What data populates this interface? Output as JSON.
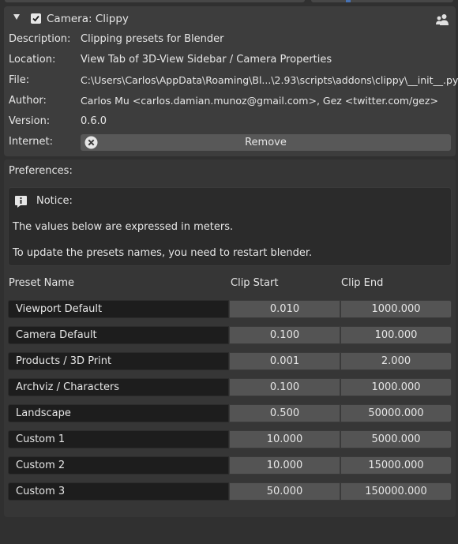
{
  "addon": {
    "title": "Camera: Clippy",
    "enabled": true,
    "fields": [
      {
        "label": "Description:",
        "value": "Clipping presets for Blender"
      },
      {
        "label": "Location:",
        "value": "View Tab of 3D-View Sidebar / Camera Properties"
      },
      {
        "label": "File:",
        "value": "C:\\Users\\Carlos\\AppData\\Roaming\\Bl...\\2.93\\scripts\\addons\\clippy\\__init__.py"
      },
      {
        "label": "Author:",
        "value": "Carlos Mu <carlos.damian.munoz@gmail.com>, Gez <twitter.com/gez>"
      },
      {
        "label": "Version:",
        "value": "0.6.0"
      }
    ],
    "internet_label": "Internet:",
    "remove_label": "Remove"
  },
  "preferences": {
    "title": "Preferences:",
    "notice": {
      "title": "Notice:",
      "line1": "The values below are expressed in meters.",
      "line2": "To update the presets names, you need to restart blender."
    },
    "columns": {
      "name": "Preset Name",
      "start": "Clip Start",
      "end": "Clip End"
    },
    "presets": [
      {
        "name": "Viewport Default",
        "start": "0.010",
        "end": "1000.000"
      },
      {
        "name": "Camera Default",
        "start": "0.100",
        "end": "100.000"
      },
      {
        "name": "Products / 3D Print",
        "start": "0.001",
        "end": "2.000"
      },
      {
        "name": "Archviz / Characters",
        "start": "0.100",
        "end": "1000.000"
      },
      {
        "name": "Landscape",
        "start": "0.500",
        "end": "50000.000"
      },
      {
        "name": "Custom 1",
        "start": "10.000",
        "end": "5000.000"
      },
      {
        "name": "Custom 2",
        "start": "10.000",
        "end": "15000.000"
      },
      {
        "name": "Custom 3",
        "start": "50.000",
        "end": "150000.000"
      }
    ]
  },
  "colors": {
    "background": "#303030",
    "panel": "#3d3d3d",
    "name_field": "#1d1d1d",
    "number_field": "#545454",
    "accent": "#4772b3"
  }
}
